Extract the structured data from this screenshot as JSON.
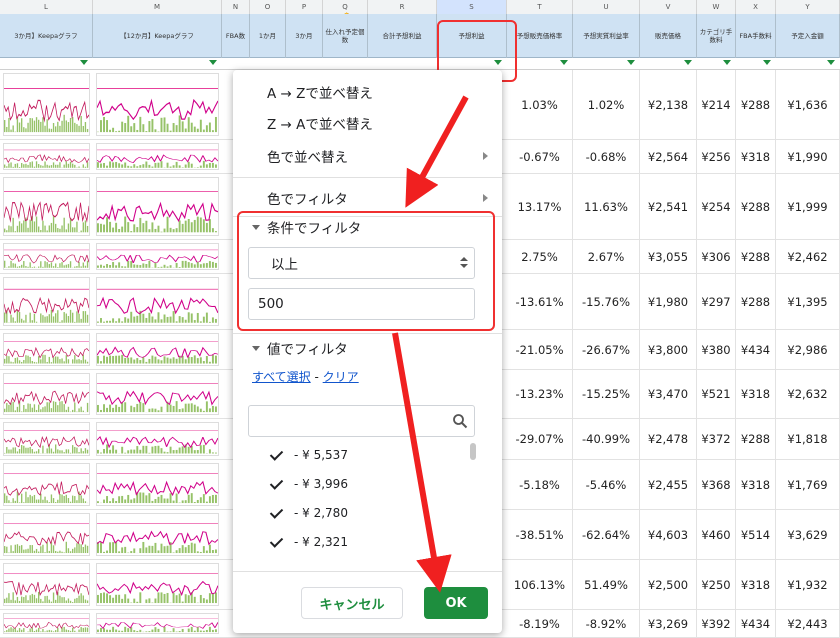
{
  "columns": {
    "letters": [
      "L",
      "M",
      "N",
      "O",
      "P",
      "Q",
      "R",
      "S",
      "T",
      "U",
      "V",
      "W",
      "X",
      "Y"
    ],
    "headers": [
      "3か月】Keepaグラフ",
      "【12か月】Keepaグラフ",
      "FBA数",
      "1か月",
      "3か月",
      "仕入れ予定個数",
      "合計予想利益",
      "予想利益",
      "予想販売価格率",
      "予想実質利益率",
      "販売価格",
      "カテゴリ手数料",
      "FBA手数料",
      "予定入金額"
    ]
  },
  "rows": [
    {
      "t": "1.03%",
      "u": "1.02%",
      "v": "¥2,138",
      "w": "¥214",
      "x": "¥288",
      "y": "¥1,636"
    },
    {
      "t": "-0.67%",
      "u": "-0.68%",
      "v": "¥2,564",
      "w": "¥256",
      "x": "¥318",
      "y": "¥1,990"
    },
    {
      "t": "13.17%",
      "u": "11.63%",
      "v": "¥2,541",
      "w": "¥254",
      "x": "¥288",
      "y": "¥1,999"
    },
    {
      "t": "2.75%",
      "u": "2.67%",
      "v": "¥3,055",
      "w": "¥306",
      "x": "¥288",
      "y": "¥2,462"
    },
    {
      "t": "-13.61%",
      "u": "-15.76%",
      "v": "¥1,980",
      "w": "¥297",
      "x": "¥288",
      "y": "¥1,395"
    },
    {
      "t": "-21.05%",
      "u": "-26.67%",
      "v": "¥3,800",
      "w": "¥380",
      "x": "¥434",
      "y": "¥2,986"
    },
    {
      "t": "-13.23%",
      "u": "-15.25%",
      "v": "¥3,470",
      "w": "¥521",
      "x": "¥318",
      "y": "¥2,632"
    },
    {
      "t": "-29.07%",
      "u": "-40.99%",
      "v": "¥2,478",
      "w": "¥372",
      "x": "¥288",
      "y": "¥1,818"
    },
    {
      "t": "-5.18%",
      "u": "-5.46%",
      "v": "¥2,455",
      "w": "¥368",
      "x": "¥318",
      "y": "¥1,769"
    },
    {
      "t": "-38.51%",
      "u": "-62.64%",
      "v": "¥4,603",
      "w": "¥460",
      "x": "¥514",
      "y": "¥3,629"
    },
    {
      "t": "106.13%",
      "u": "51.49%",
      "v": "¥2,500",
      "w": "¥250",
      "x": "¥318",
      "y": "¥1,932"
    },
    {
      "t": "-8.19%",
      "u": "-8.92%",
      "v": "¥3,269",
      "w": "¥392",
      "x": "¥434",
      "y": "¥2,443"
    }
  ],
  "menu": {
    "sort_az": "A → Zで並べ替え",
    "sort_za": "Z → Aで並べ替え",
    "sort_color": "色で並べ替え",
    "filter_color": "色でフィルタ",
    "filter_condition": "条件でフィルタ",
    "condition_selected": "以上",
    "condition_value": "500",
    "filter_values": "値でフィルタ",
    "select_all": "すべて選択",
    "link_sep": " - ",
    "clear": "クリア",
    "search_placeholder": "",
    "values": [
      "- ¥ 5,537",
      "- ¥ 3,996",
      "- ¥ 2,780",
      "- ¥ 2,321"
    ],
    "cancel": "キャンセル",
    "ok": "OK"
  },
  "colors": {
    "accent": "#1e8e3e",
    "highlight": "#f03030",
    "header_bg": "#cfe2f3"
  },
  "icons": {
    "hand": "hand-pointer-icon",
    "search": "search-icon"
  }
}
